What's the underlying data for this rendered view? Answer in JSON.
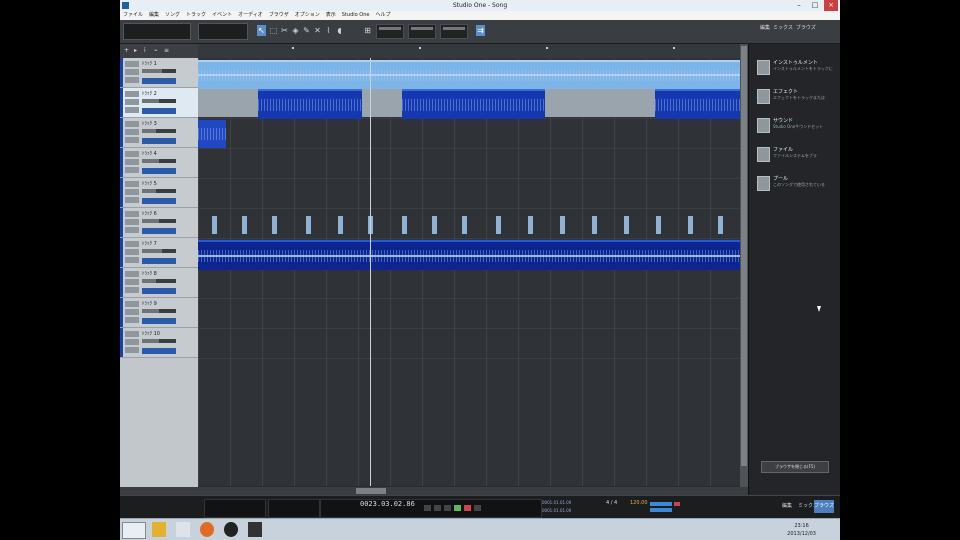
{
  "window": {
    "title": "Studio One - Song"
  },
  "menu": [
    "ファイル",
    "編集",
    "ソング",
    "トラック",
    "イベント",
    "オーディオ",
    "ブラウザ",
    "オプション",
    "表示",
    "Studio One",
    "ヘルプ"
  ],
  "toolbar": {
    "tools": [
      "select-tool",
      "range-tool",
      "split-tool",
      "eraser-tool",
      "paint-tool",
      "mute-tool",
      "bend-tool",
      "listen-tool"
    ]
  },
  "right_tabs": [
    "編集",
    "ミックス",
    "ブラウズ"
  ],
  "tracks": [
    {
      "name": "ﾄﾗｯｸ 1",
      "level": 0.6,
      "selected": false
    },
    {
      "name": "ﾄﾗｯｸ 2",
      "level": 0.5,
      "selected": true
    },
    {
      "name": "ﾄﾗｯｸ 3",
      "level": 0.4,
      "selected": false
    },
    {
      "name": "ﾄﾗｯｸ 4",
      "level": 0.5,
      "selected": false
    },
    {
      "name": "ﾄﾗｯｸ 5",
      "level": 0.4,
      "selected": false
    },
    {
      "name": "ﾄﾗｯｸ 6",
      "level": 0.5,
      "selected": false
    },
    {
      "name": "ﾄﾗｯｸ 7",
      "level": 0.6,
      "selected": false
    },
    {
      "name": "ﾄﾗｯｸ 8",
      "level": 0.4,
      "selected": false
    },
    {
      "name": "ﾄﾗｯｸ 9",
      "level": 0.5,
      "selected": false
    },
    {
      "name": "ﾄﾗｯｸ 10",
      "level": 0.5,
      "selected": false
    }
  ],
  "browser": {
    "items": [
      {
        "title": "インストゥルメント",
        "desc": "インストゥルメントをトラックに"
      },
      {
        "title": "エフェクト",
        "desc": "エフェクトをトラックまたは"
      },
      {
        "title": "サウンド",
        "desc": "Studio Oneサウンドセット"
      },
      {
        "title": "ファイル",
        "desc": "ファイルシステムをブラ"
      },
      {
        "title": "プール",
        "desc": "このソングで使用されている"
      }
    ],
    "button": "ブラウザを閉じる(F5)"
  },
  "transport": {
    "time": "0023.03.02.86",
    "left_time": "0001.01.01.00",
    "right_time": "0001.01.01.00",
    "tempo": "120.00",
    "signature": "4 / 4"
  },
  "footer_tabs": [
    "編集",
    "ミックス",
    "ブラウズ"
  ],
  "taskbar": {
    "clock": "23:16",
    "date": "2013/12/03"
  }
}
